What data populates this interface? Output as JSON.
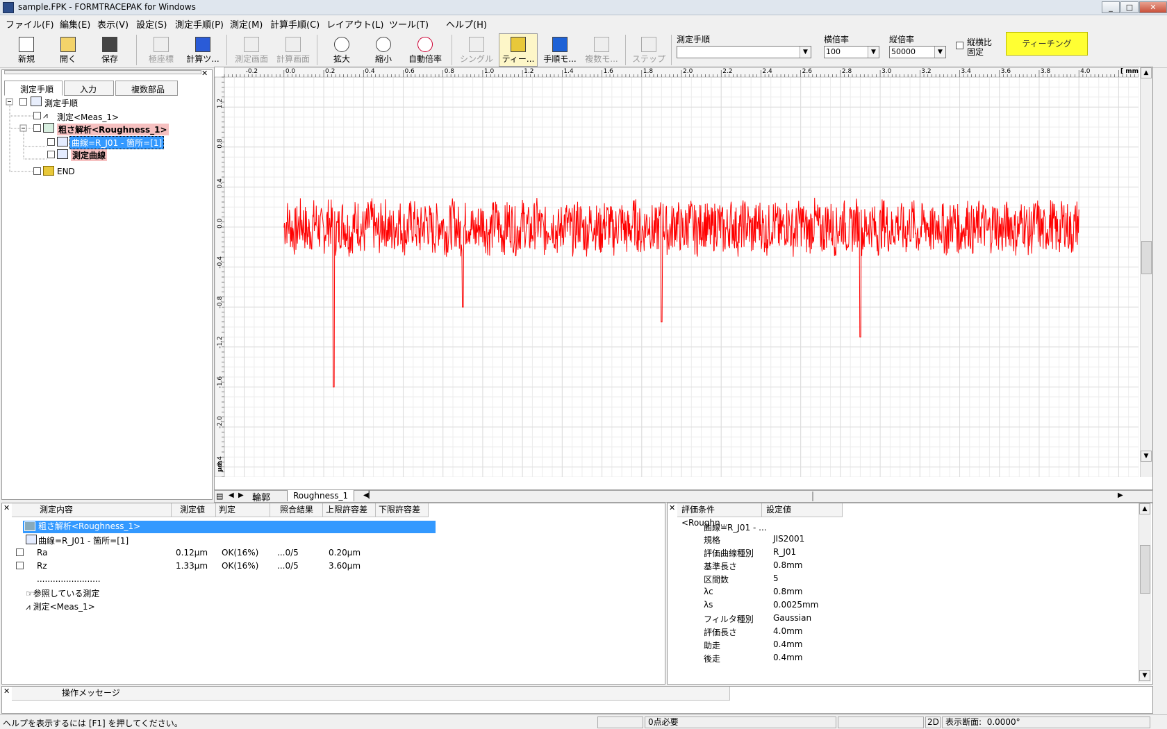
{
  "window": {
    "title": "sample.FPK - FORMTRACEPAK for Windows",
    "btn_min": "_",
    "btn_max": "□",
    "btn_close": "✕"
  },
  "menu": [
    "ファイル(F)",
    "編集(E)",
    "表示(V)",
    "設定(S)",
    "測定手順(P)",
    "測定(M)",
    "計算手順(C)",
    "レイアウト(L)",
    "ツール(T)",
    "ヘルプ(H)"
  ],
  "toolbar": {
    "new": "新規",
    "open": "開く",
    "save": "保存",
    "polar": "極座標",
    "calc_tool": "計算ツ...",
    "meas_screen": "測定画面",
    "calc_screen": "計算画面",
    "zoom_in": "拡大",
    "zoom_out": "縮小",
    "auto_zoom": "自動倍率",
    "single": "シングル",
    "teach_btn": "ティー...",
    "proc_mode": "手順モ...",
    "multi_mode": "複数モ...",
    "step": "ステップ"
  },
  "controls": {
    "procedure_label": "測定手順",
    "procedure_value": "",
    "hmag_label": "横倍率",
    "hmag_value": "100",
    "vmag_label": "縦倍率",
    "vmag_value": "50000",
    "aspect_label_1": "縦横比",
    "aspect_label_2": "固定",
    "teaching": "ティーチング"
  },
  "left_tabs": [
    "測定手順",
    "入力",
    "複数部品"
  ],
  "tree": {
    "root": "測定手順",
    "meas": "測定<Meas_1>",
    "rough": "粗さ解析<Roughness_1>",
    "curve": "曲線=R_J01 - 箇所=[1]",
    "meas_curve": "測定曲線",
    "end": "END"
  },
  "graph": {
    "x_unit": "mm",
    "x_ticks": [
      "-0.2",
      "0.0",
      "0.2",
      "0.4",
      "0.6",
      "0.8",
      "1.0",
      "1.2",
      "1.4",
      "1.6",
      "1.8",
      "2.0",
      "2.2",
      "2.4",
      "2.6",
      "2.8",
      "3.0",
      "3.2",
      "3.4",
      "3.6",
      "3.8",
      "4.0"
    ],
    "y_ticks": [
      "1.2",
      "0.8",
      "0.4",
      "0.0",
      "-0.4",
      "-0.8",
      "-1.2",
      "-1.6",
      "-2.0",
      "-2.4"
    ],
    "y_unit": "μm",
    "profile_color": "#ff0000",
    "sheet_tabs": [
      "輪郭",
      "Roughness_1"
    ]
  },
  "chart_data": {
    "type": "line",
    "xlabel": "mm",
    "ylabel": "μm",
    "xlim": [
      -0.3,
      4.3
    ],
    "ylim": [
      -2.5,
      1.5
    ],
    "series": [
      {
        "x": [
          0.0,
          0.1,
          0.2,
          0.25,
          0.3,
          0.4,
          0.5,
          0.6,
          0.8,
          0.9,
          1.0,
          1.2,
          1.4,
          1.6,
          1.8,
          1.9,
          2.0,
          2.2,
          2.4,
          2.6,
          2.8,
          2.9,
          3.0,
          3.2,
          3.4,
          3.6,
          3.8,
          3.9,
          4.0
        ],
        "y": [
          -0.1,
          0.3,
          -0.3,
          -1.6,
          0.2,
          -0.2,
          0.25,
          -0.3,
          0.45,
          -0.8,
          0.2,
          -0.3,
          0.25,
          -0.2,
          0.1,
          -0.95,
          0.3,
          -0.3,
          0.25,
          -0.2,
          0.2,
          -1.1,
          0.25,
          -0.3,
          0.3,
          -0.2,
          0.25,
          -0.2,
          0.0
        ]
      }
    ]
  },
  "results": {
    "headers": [
      "測定内容",
      "測定値",
      "判定",
      "照合結果",
      "上限許容差",
      "下限許容差"
    ],
    "row_rough": "粗さ解析<Roughness_1>",
    "row_curve": "曲線=R_J01 - 箇所=[1]",
    "rows": [
      {
        "name": "Ra",
        "value": "0.12μm",
        "judge": "OK(16%)",
        "match": "...0/5",
        "upper": "0.20μm"
      },
      {
        "name": "Rz",
        "value": "1.33μm",
        "judge": "OK(16%)",
        "match": "...0/5",
        "upper": "3.60μm"
      }
    ],
    "dots": "........................",
    "ref_label": "参照している測定",
    "ref_meas": "測定<Meas_1>"
  },
  "conditions": {
    "headers": [
      "評価条件<Roughn...",
      "設定値"
    ],
    "curve": "曲線=R_J01 - ...",
    "rows": [
      [
        "規格",
        "JIS2001"
      ],
      [
        "評価曲線種別",
        "R_J01"
      ],
      [
        "基準長さ",
        "0.8mm"
      ],
      [
        "区間数",
        "5"
      ],
      [
        "λc",
        "0.8mm"
      ],
      [
        "λs",
        "0.0025mm"
      ],
      [
        "フィルタ種別",
        "Gaussian"
      ],
      [
        "評価長さ",
        "4.0mm"
      ],
      [
        "助走",
        "0.4mm"
      ],
      [
        "後走",
        "0.4mm"
      ]
    ]
  },
  "messages": {
    "header": "操作メッセージ",
    "body": ""
  },
  "status": {
    "help": "ヘルプを表示するには [F1] を押してください。",
    "points": "0点必要",
    "mode": "2D",
    "angle_label": "表示断面:",
    "angle_value": "0.0000°"
  }
}
